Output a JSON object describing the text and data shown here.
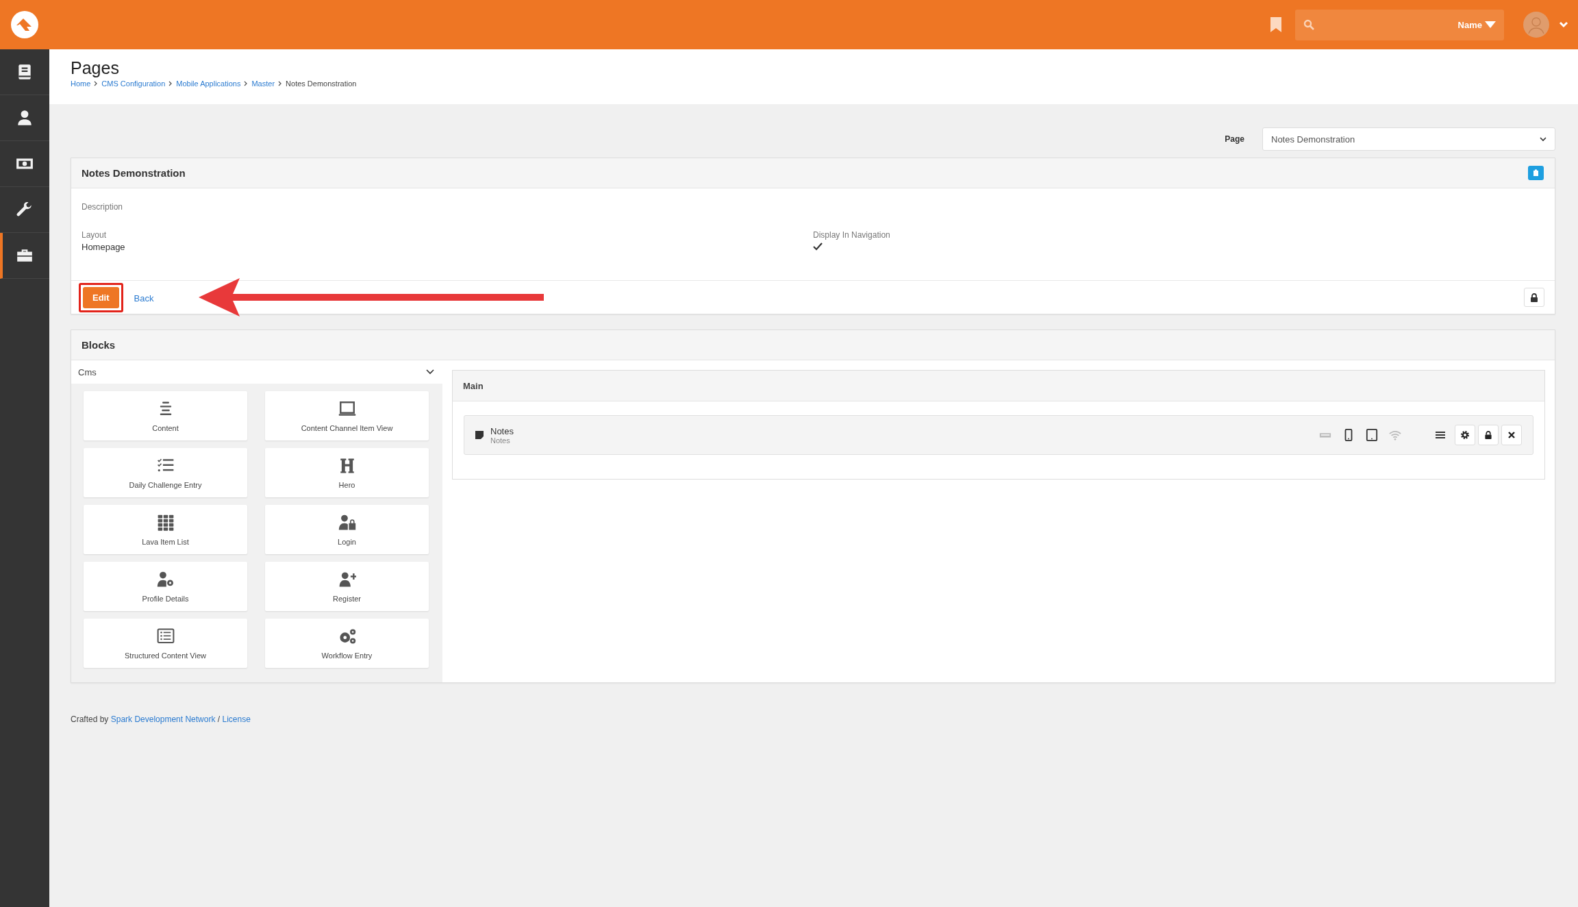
{
  "header": {
    "search": {
      "filter_label": "Name"
    }
  },
  "sidebar": {
    "items": [
      {
        "kind": "book",
        "selected": false
      },
      {
        "kind": "person",
        "selected": false
      },
      {
        "kind": "money",
        "selected": false
      },
      {
        "kind": "wrench",
        "selected": false
      },
      {
        "kind": "briefcase",
        "selected": true
      }
    ]
  },
  "page_title": "Pages",
  "breadcrumbs": [
    {
      "label": "Home",
      "current": false
    },
    {
      "label": "CMS Configuration",
      "current": false
    },
    {
      "label": "Mobile Applications",
      "current": false
    },
    {
      "label": "Master",
      "current": false
    },
    {
      "label": "Notes Demonstration",
      "current": true
    }
  ],
  "page_picker": {
    "label": "Page",
    "value": "Notes Demonstration"
  },
  "detail_panel": {
    "title": "Notes Demonstration",
    "description_label": "Description",
    "fields": [
      {
        "label": "Layout",
        "kind": "text",
        "value": "Homepage"
      },
      {
        "label": "Display In Navigation",
        "kind": "check",
        "checked": true
      }
    ],
    "actions": [
      {
        "label": "Edit",
        "kind": "primary",
        "highlighted": true
      },
      {
        "label": "Back",
        "kind": "link",
        "highlighted": false
      }
    ]
  },
  "blocks_panel": {
    "title": "Blocks",
    "category": "Cms",
    "block_types": [
      {
        "label": "Content",
        "kind": "align"
      },
      {
        "label": "Content Channel Item View",
        "kind": "laptop"
      },
      {
        "label": "Daily Challenge Entry",
        "kind": "checklist"
      },
      {
        "label": "Hero",
        "kind": "heading"
      },
      {
        "label": "Lava Item List",
        "kind": "grid"
      },
      {
        "label": "Login",
        "kind": "user-lock"
      },
      {
        "label": "Profile Details",
        "kind": "user-gear"
      },
      {
        "label": "Register",
        "kind": "user-plus"
      },
      {
        "label": "Structured Content View",
        "kind": "list-box"
      },
      {
        "label": "Workflow Entry",
        "kind": "gears"
      }
    ],
    "zones": [
      {
        "title": "Main",
        "blocks": [
          {
            "name": "Notes",
            "type": "Notes",
            "devices": [
              {
                "kind": "desktop",
                "on": false
              },
              {
                "kind": "phone",
                "on": true
              },
              {
                "kind": "tablet",
                "on": true
              },
              {
                "kind": "wifi",
                "on": false
              }
            ]
          }
        ]
      }
    ]
  },
  "footer": {
    "prefix": "Crafted by",
    "links": [
      "Spark Development Network",
      "License"
    ],
    "separator": "/"
  }
}
